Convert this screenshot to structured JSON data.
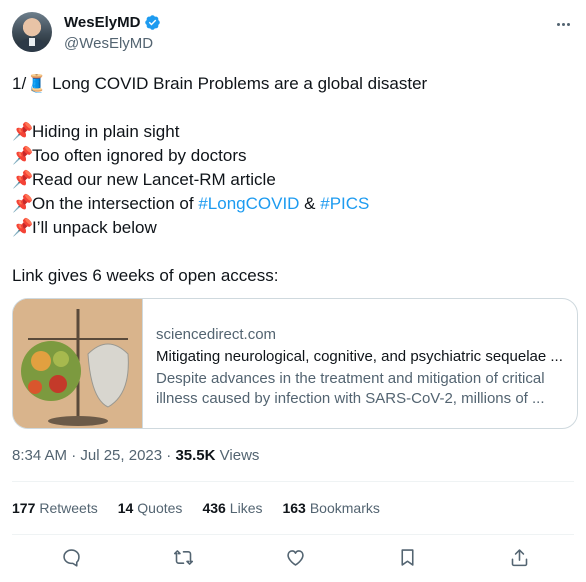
{
  "author": {
    "display_name": "WesElyMD",
    "handle": "@WesElyMD",
    "verified": true
  },
  "tweet": {
    "line1": "1/🧵 Long COVID Brain Problems are a global disaster",
    "bullet_emoji": "📌",
    "bullets": [
      "Hiding in plain sight",
      "Too often ignored by doctors",
      "Read our new Lancet-RM article"
    ],
    "bullet4_prefix": "On the intersection of ",
    "hashtag1": "#LongCOVID",
    "bullet4_mid": " & ",
    "hashtag2": "#PICS",
    "bullet5": "I’ll unpack below",
    "link_line": "Link gives 6 weeks of open access:"
  },
  "card": {
    "domain": "sciencedirect.com",
    "title": "Mitigating neurological, cognitive, and psychiatric sequelae ...",
    "description": "Despite advances in the treatment and mitigation of critical illness caused by infection with SARS-CoV-2, millions of ..."
  },
  "meta": {
    "timestamp": "8:34 AM · Jul 25, 2023",
    "separator": " · ",
    "views_count": "35.5K",
    "views_label": "Views"
  },
  "stats": {
    "retweets_count": "177",
    "retweets_label": "Retweets",
    "quotes_count": "14",
    "quotes_label": "Quotes",
    "likes_count": "436",
    "likes_label": "Likes",
    "bookmarks_count": "163",
    "bookmarks_label": "Bookmarks"
  },
  "icons": {
    "verified": "verified-badge-icon",
    "more": "more-icon",
    "reply": "reply-icon",
    "retweet": "retweet-icon",
    "like": "heart-icon",
    "bookmark": "bookmark-icon",
    "share": "share-icon"
  },
  "colors": {
    "accent": "#1d9bf0",
    "text": "#0f1419",
    "secondary": "#536471",
    "border": "#cfd9de"
  }
}
